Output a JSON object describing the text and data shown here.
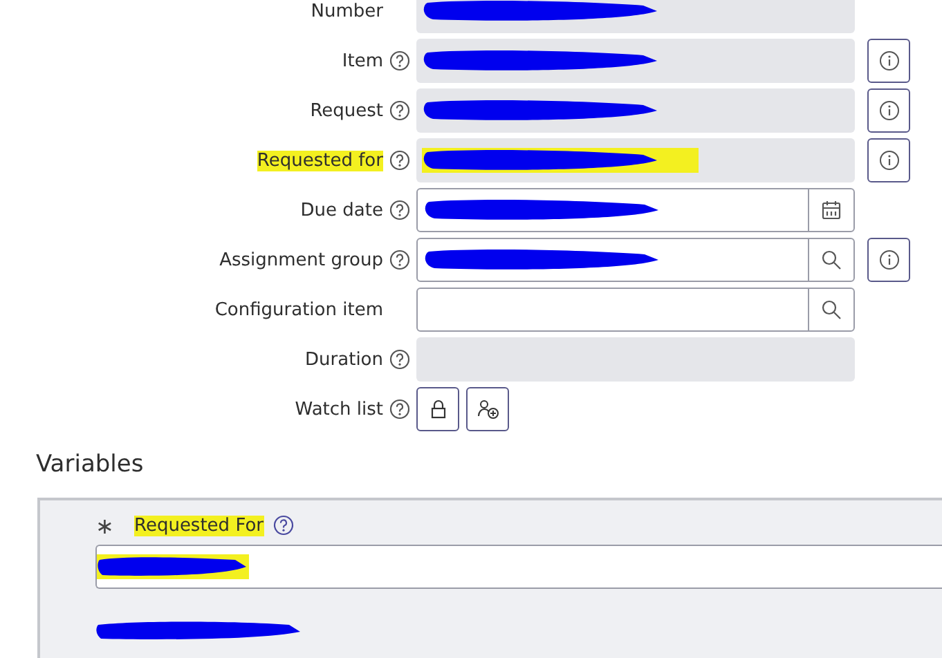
{
  "fields": [
    {
      "label": "Number",
      "kind": "readonly",
      "help": false,
      "info": false,
      "redacted": true,
      "highlighted": false
    },
    {
      "label": "Item",
      "kind": "readonly",
      "help": true,
      "info": true,
      "redacted": true,
      "highlighted": false
    },
    {
      "label": "Request",
      "kind": "readonly",
      "help": true,
      "info": true,
      "redacted": true,
      "highlighted": false
    },
    {
      "label": "Requested for",
      "kind": "readonly",
      "help": true,
      "info": true,
      "redacted": true,
      "highlighted": true
    },
    {
      "label": "Due date",
      "kind": "date",
      "help": true,
      "info": false,
      "redacted": true,
      "highlighted": false
    },
    {
      "label": "Assignment group",
      "kind": "lookup",
      "help": true,
      "info": true,
      "redacted": true,
      "highlighted": false
    },
    {
      "label": "Configuration item",
      "kind": "lookup",
      "help": false,
      "info": false,
      "redacted": false,
      "highlighted": false
    },
    {
      "label": "Duration",
      "kind": "readonly",
      "help": true,
      "info": false,
      "redacted": false,
      "highlighted": false
    },
    {
      "label": "Watch list",
      "kind": "watchlist",
      "help": true,
      "info": false,
      "redacted": false,
      "highlighted": false
    }
  ],
  "variables": {
    "title": "Variables",
    "items": [
      {
        "label": "Requested For",
        "required_mark": "∗",
        "help": true,
        "highlighted": true,
        "redacted": true
      },
      {
        "redacted": true
      }
    ]
  }
}
